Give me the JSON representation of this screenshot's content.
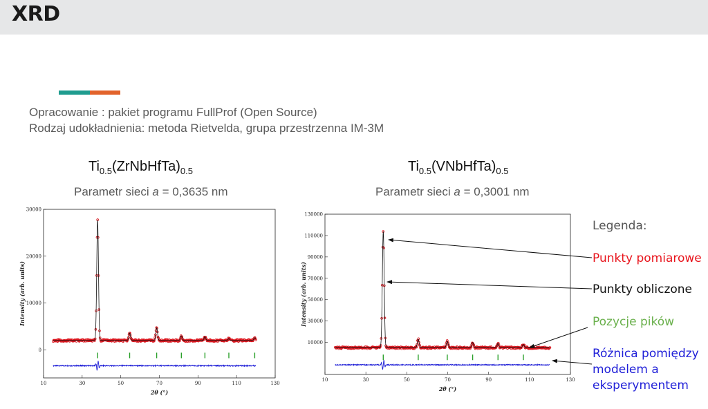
{
  "header": {
    "title": "XRD"
  },
  "description": {
    "line1": "Opracowanie : pakiet programu FullProf  (Open Source)",
    "line2": "Rodzaj udokładnienia: metoda Rietvelda, grupa przestrzenna IM-3M"
  },
  "samples": [
    {
      "formula_base": "Ti",
      "sub1": "0.5",
      "mid": "(ZrNbHfTa)",
      "sub2": "0.5",
      "param_prefix": "Parametr sieci ",
      "param_var": "a",
      "param_value": " = 0,3635 nm"
    },
    {
      "formula_base": "Ti",
      "sub1": "0.5",
      "mid": "(VNbHfTa)",
      "sub2": "0.5",
      "param_prefix": "Parametr sieci ",
      "param_var": "a",
      "param_value": " = 0,3001 nm"
    }
  ],
  "legend": {
    "title": "Legenda:",
    "items": [
      {
        "label": "Punkty pomiarowe",
        "color": "#e8141c"
      },
      {
        "label": "Punkty obliczone",
        "color": "#111111"
      },
      {
        "label": "Pozycje pików",
        "color": "#6ab04c"
      },
      {
        "label_lines": [
          "Różnica pomiędzy",
          "modelem a",
          "eksperymentem"
        ],
        "color": "#2020d8"
      }
    ]
  },
  "chart_data": [
    {
      "type": "line",
      "xlabel": "2θ (°)",
      "ylabel": "Intensity (arb. units)",
      "xlim": [
        10,
        130
      ],
      "ylim": [
        -6000,
        30000
      ],
      "x_ticks": [
        "10",
        "30",
        "50",
        "70",
        "90",
        "110",
        "130"
      ],
      "y_ticks": [
        "0",
        "10000",
        "20000",
        "30000"
      ],
      "background": 2000,
      "peaks": [
        {
          "x": 38.0,
          "y": 27800
        },
        {
          "x": 54.6,
          "y": 3600
        },
        {
          "x": 68.6,
          "y": 4700
        },
        {
          "x": 81.4,
          "y": 3000
        },
        {
          "x": 93.6,
          "y": 2800
        },
        {
          "x": 106.0,
          "y": 2400
        },
        {
          "x": 119.4,
          "y": 2600
        }
      ],
      "bragg_positions": [
        38.0,
        54.6,
        68.6,
        81.4,
        93.6,
        106.0,
        119.4
      ],
      "bragg_level": -1200,
      "difference_level": -3400,
      "x_range_data": [
        15,
        120
      ]
    },
    {
      "type": "line",
      "xlabel": "2θ (°)",
      "ylabel": "Intensity (arb. units)",
      "xlim": [
        10,
        130
      ],
      "ylim": [
        -20000,
        130000
      ],
      "x_ticks": [
        "10",
        "30",
        "50",
        "70",
        "90",
        "110",
        "130"
      ],
      "y_ticks": [
        "10000",
        "30000",
        "50000",
        "70000",
        "90000",
        "110000",
        "130000"
      ],
      "background": 5000,
      "peaks": [
        {
          "x": 38.5,
          "y": 114000
        },
        {
          "x": 55.6,
          "y": 13000
        },
        {
          "x": 69.8,
          "y": 11000
        },
        {
          "x": 82.2,
          "y": 10000
        },
        {
          "x": 94.6,
          "y": 9000
        },
        {
          "x": 107.0,
          "y": 8000
        }
      ],
      "bragg_positions": [
        38.5,
        55.6,
        69.8,
        82.2,
        94.6,
        107.0
      ],
      "bragg_level": -4000,
      "difference_level": -11000,
      "x_range_data": [
        15,
        120
      ]
    }
  ]
}
